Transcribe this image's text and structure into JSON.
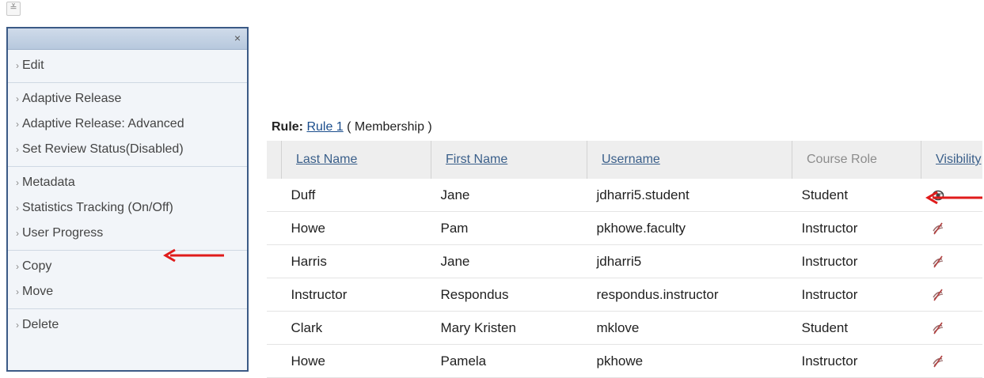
{
  "top": {
    "collapse_glyph": "≚"
  },
  "menu": {
    "close_glyph": "×",
    "groups": [
      {
        "items": [
          {
            "label": "Edit"
          }
        ]
      },
      {
        "items": [
          {
            "label": "Adaptive Release"
          },
          {
            "label": "Adaptive Release: Advanced"
          },
          {
            "label": "Set Review Status(Disabled)"
          }
        ]
      },
      {
        "items": [
          {
            "label": "Metadata"
          },
          {
            "label": "Statistics Tracking (On/Off)"
          },
          {
            "label": "User Progress"
          }
        ]
      },
      {
        "items": [
          {
            "label": "Copy"
          },
          {
            "label": "Move"
          }
        ]
      },
      {
        "items": [
          {
            "label": "Delete"
          }
        ]
      }
    ],
    "chevron": "›"
  },
  "rule": {
    "prefix": "Rule:",
    "link": "Rule 1",
    "suffix": "( Membership )"
  },
  "table": {
    "headers": {
      "last_name": "Last Name",
      "first_name": "First Name",
      "username": "Username",
      "course_role": "Course Role",
      "visibility": "Visibility"
    },
    "rows": [
      {
        "last": "Duff",
        "first": "Jane",
        "username": "jdharri5.student",
        "role": "Student",
        "visible": true
      },
      {
        "last": "Howe",
        "first": "Pam",
        "username": "pkhowe.faculty",
        "role": "Instructor",
        "visible": false
      },
      {
        "last": "Harris",
        "first": "Jane",
        "username": "jdharri5",
        "role": "Instructor",
        "visible": false
      },
      {
        "last": "Instructor",
        "first": "Respondus",
        "username": "respondus.instructor",
        "role": "Instructor",
        "visible": false
      },
      {
        "last": "Clark",
        "first": "Mary Kristen",
        "username": "mklove",
        "role": "Student",
        "visible": false
      },
      {
        "last": "Howe",
        "first": "Pamela",
        "username": "pkhowe",
        "role": "Instructor",
        "visible": false
      }
    ]
  },
  "colors": {
    "arrow": "#e01b1b",
    "menu_border": "#3b5a86",
    "header_link": "#3a5f8a"
  }
}
